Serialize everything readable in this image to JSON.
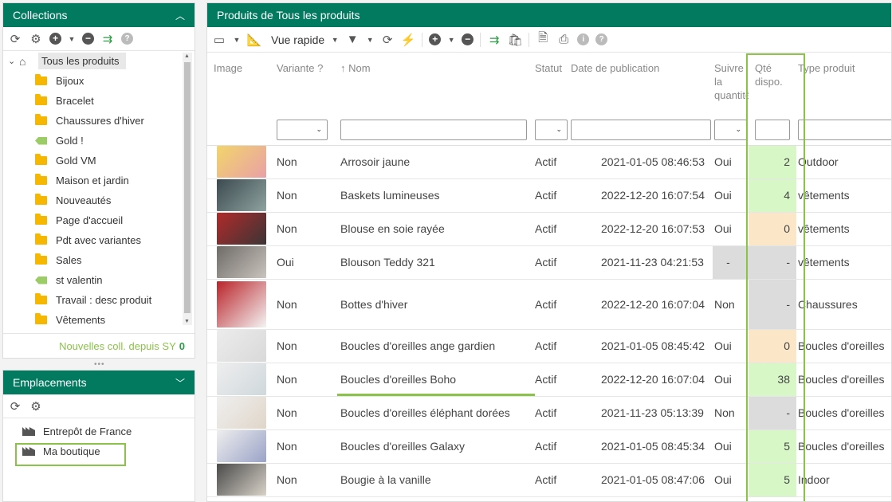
{
  "collections": {
    "title": "Collections",
    "toolbar_icons": [
      "refresh-icon",
      "gear-icon",
      "add-icon",
      "dropdown-icon",
      "remove-icon",
      "shopify-sync-icon",
      "help-icon"
    ],
    "root_label": "Tous les produits",
    "items": [
      {
        "label": "Bijoux",
        "icon": "folder-icon"
      },
      {
        "label": "Bracelet",
        "icon": "folder-icon"
      },
      {
        "label": "Chaussures d'hiver",
        "icon": "folder-icon"
      },
      {
        "label": "Gold !",
        "icon": "tag-icon"
      },
      {
        "label": "Gold VM",
        "icon": "folder-icon"
      },
      {
        "label": "Maison et jardin",
        "icon": "folder-icon"
      },
      {
        "label": "Nouveautés",
        "icon": "folder-icon"
      },
      {
        "label": "Page d'accueil",
        "icon": "folder-icon"
      },
      {
        "label": "Pdt avec variantes",
        "icon": "folder-icon"
      },
      {
        "label": "Sales",
        "icon": "folder-icon"
      },
      {
        "label": "st valentin",
        "icon": "tag-icon"
      },
      {
        "label": "Travail : desc produit",
        "icon": "folder-icon"
      },
      {
        "label": "Vêtements",
        "icon": "folder-icon"
      }
    ],
    "footer_text": "Nouvelles coll. depuis SY",
    "footer_count": "0"
  },
  "emplacements": {
    "title": "Emplacements",
    "items": [
      "Entrepôt de France",
      "Ma boutique"
    ]
  },
  "products": {
    "title": "Produits de Tous les produits",
    "view_label": "Vue rapide",
    "columns": [
      "Image",
      "Variante ?",
      "Nom",
      "Statut",
      "Date de publication",
      "Suivre la quantité",
      "Qté dispo.",
      "Type produit"
    ],
    "rows": [
      {
        "variante": "Non",
        "nom": "Arrosoir jaune",
        "statut": "Actif",
        "date": "2021-01-05 08:46:53",
        "suivre": "Oui",
        "qty": "2",
        "qty_state": "green",
        "type": "Outdoor",
        "img": [
          "#f2d56b",
          "#e9a0a6"
        ]
      },
      {
        "variante": "Non",
        "nom": "Baskets lumineuses",
        "statut": "Actif",
        "date": "2022-12-20 16:07:54",
        "suivre": "Oui",
        "qty": "4",
        "qty_state": "green",
        "type": "vêtements",
        "img": [
          "#3c4a4f",
          "#8ea3a0"
        ]
      },
      {
        "variante": "Non",
        "nom": "Blouse en soie rayée",
        "statut": "Actif",
        "date": "2022-12-20 16:07:53",
        "suivre": "Oui",
        "qty": "0",
        "qty_state": "orange",
        "type": "vêtements",
        "img": [
          "#b02a2a",
          "#3b3536"
        ]
      },
      {
        "variante": "Oui",
        "nom": "Blouson Teddy 321",
        "statut": "Actif",
        "date": "2021-11-23 04:21:53",
        "suivre": "-",
        "qty": "-",
        "qty_state": "grey",
        "type": "vêtements",
        "img": [
          "#6e6a66",
          "#c9c4bd"
        ]
      },
      {
        "variante": "Non",
        "nom": "Bottes d'hiver",
        "statut": "Actif",
        "date": "2022-12-20 16:07:04",
        "suivre": "Non",
        "qty": "-",
        "qty_state": "grey",
        "type": "Chaussures",
        "img": [
          "#b8242a",
          "#f4f4f4"
        ]
      },
      {
        "variante": "Non",
        "nom": "Boucles d'oreilles ange gardien",
        "statut": "Actif",
        "date": "2021-01-05 08:45:42",
        "suivre": "Oui",
        "qty": "0",
        "qty_state": "orange",
        "type": "Boucles d'oreilles",
        "img": [
          "#ececec",
          "#d9d9d9"
        ]
      },
      {
        "variante": "Non",
        "nom": "Boucles d'oreilles Boho",
        "statut": "Actif",
        "date": "2022-12-20 16:07:04",
        "suivre": "Oui",
        "qty": "38",
        "qty_state": "green",
        "type": "Boucles d'oreilles",
        "img": [
          "#eeeeee",
          "#cfd8dc"
        ]
      },
      {
        "variante": "Non",
        "nom": "Boucles d'oreilles éléphant dorées",
        "statut": "Actif",
        "date": "2021-11-23 05:13:39",
        "suivre": "Non",
        "qty": "-",
        "qty_state": "grey",
        "type": "Boucles d'oreilles",
        "img": [
          "#efefef",
          "#e0d6c9"
        ]
      },
      {
        "variante": "Non",
        "nom": "Boucles d'oreilles Galaxy",
        "statut": "Actif",
        "date": "2021-01-05 08:45:34",
        "suivre": "Oui",
        "qty": "5",
        "qty_state": "green",
        "type": "Boucles d'oreilles",
        "img": [
          "#eeeeee",
          "#9aa3c7"
        ]
      },
      {
        "variante": "Non",
        "nom": "Bougie à la vanille",
        "statut": "Actif",
        "date": "2021-01-05 08:47:06",
        "suivre": "Oui",
        "qty": "5",
        "qty_state": "green",
        "type": "Indoor",
        "img": [
          "#4a4a4a",
          "#d8d2c8"
        ]
      }
    ]
  },
  "colors": {
    "header_green": "#017a5f",
    "highlight_green": "#8bc34a",
    "qty_green": "#d7f7c7",
    "qty_orange": "#fbe6c8",
    "qty_grey": "#dcdcdc"
  }
}
